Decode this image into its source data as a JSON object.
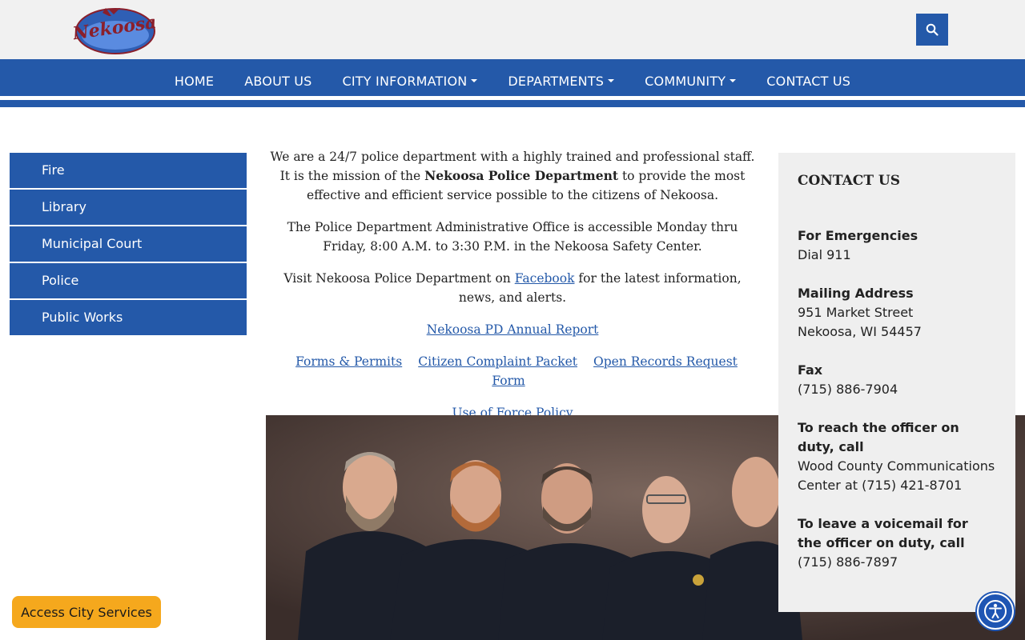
{
  "header": {
    "logo_text": "Nekoosa",
    "search_icon": "search-icon"
  },
  "nav": {
    "items": [
      {
        "label": "HOME",
        "dropdown": false
      },
      {
        "label": "ABOUT US",
        "dropdown": false
      },
      {
        "label": "CITY INFORMATION",
        "dropdown": true
      },
      {
        "label": "DEPARTMENTS",
        "dropdown": true
      },
      {
        "label": "COMMUNITY",
        "dropdown": true
      },
      {
        "label": "CONTACT US",
        "dropdown": false
      }
    ]
  },
  "sidebar": {
    "items": [
      {
        "label": "Fire"
      },
      {
        "label": "Library"
      },
      {
        "label": "Municipal Court"
      },
      {
        "label": "Police"
      },
      {
        "label": "Public Works"
      }
    ]
  },
  "main": {
    "intro_part1": "We are a 24/7 police department with a highly trained and professional staff. It is the mission of the ",
    "intro_bold": "Nekoosa Police Department",
    "intro_part2": " to provide the most effective and efficient service possible to the citizens of Nekoosa.",
    "hours": "The Police Department Administrative Office is accessible Monday thru Friday, 8:00 A.M. to 3:30 P.M. in the Nekoosa Safety Center.",
    "visit_part1": "Visit Nekoosa Police Department on ",
    "visit_link": "Facebook",
    "visit_part2": " for the latest information, news, and alerts.",
    "annual_report": "Nekoosa PD Annual Report",
    "forms_permits": "Forms & Permits",
    "complaint_packet": "Citizen Complaint Packet",
    "open_records": "Open Records Request Form",
    "use_of_force": "Use of Force Policy"
  },
  "contact": {
    "title": "CONTACT US",
    "emergency_label": "For Emergencies",
    "emergency_value": "Dial 911",
    "mailing_label": "Mailing Address",
    "mailing_line1": "951 Market Street",
    "mailing_line2": "Nekoosa, WI 54457",
    "fax_label": "Fax",
    "fax_value": "(715) 886-7904",
    "officer_label": "To reach the officer on duty, call",
    "officer_value": "Wood County Communications Center at (715) 421-8701",
    "voicemail_label": "To leave a voicemail for the officer on duty, call",
    "voicemail_value": "(715) 886-7897"
  },
  "floating": {
    "services_label": "Access City Services",
    "accessibility_icon": "accessibility-icon"
  },
  "colors": {
    "brand_blue": "#2459a9",
    "accent_orange": "#f5a81d",
    "header_bg": "#f1f1f1",
    "card_bg": "#efefef"
  }
}
